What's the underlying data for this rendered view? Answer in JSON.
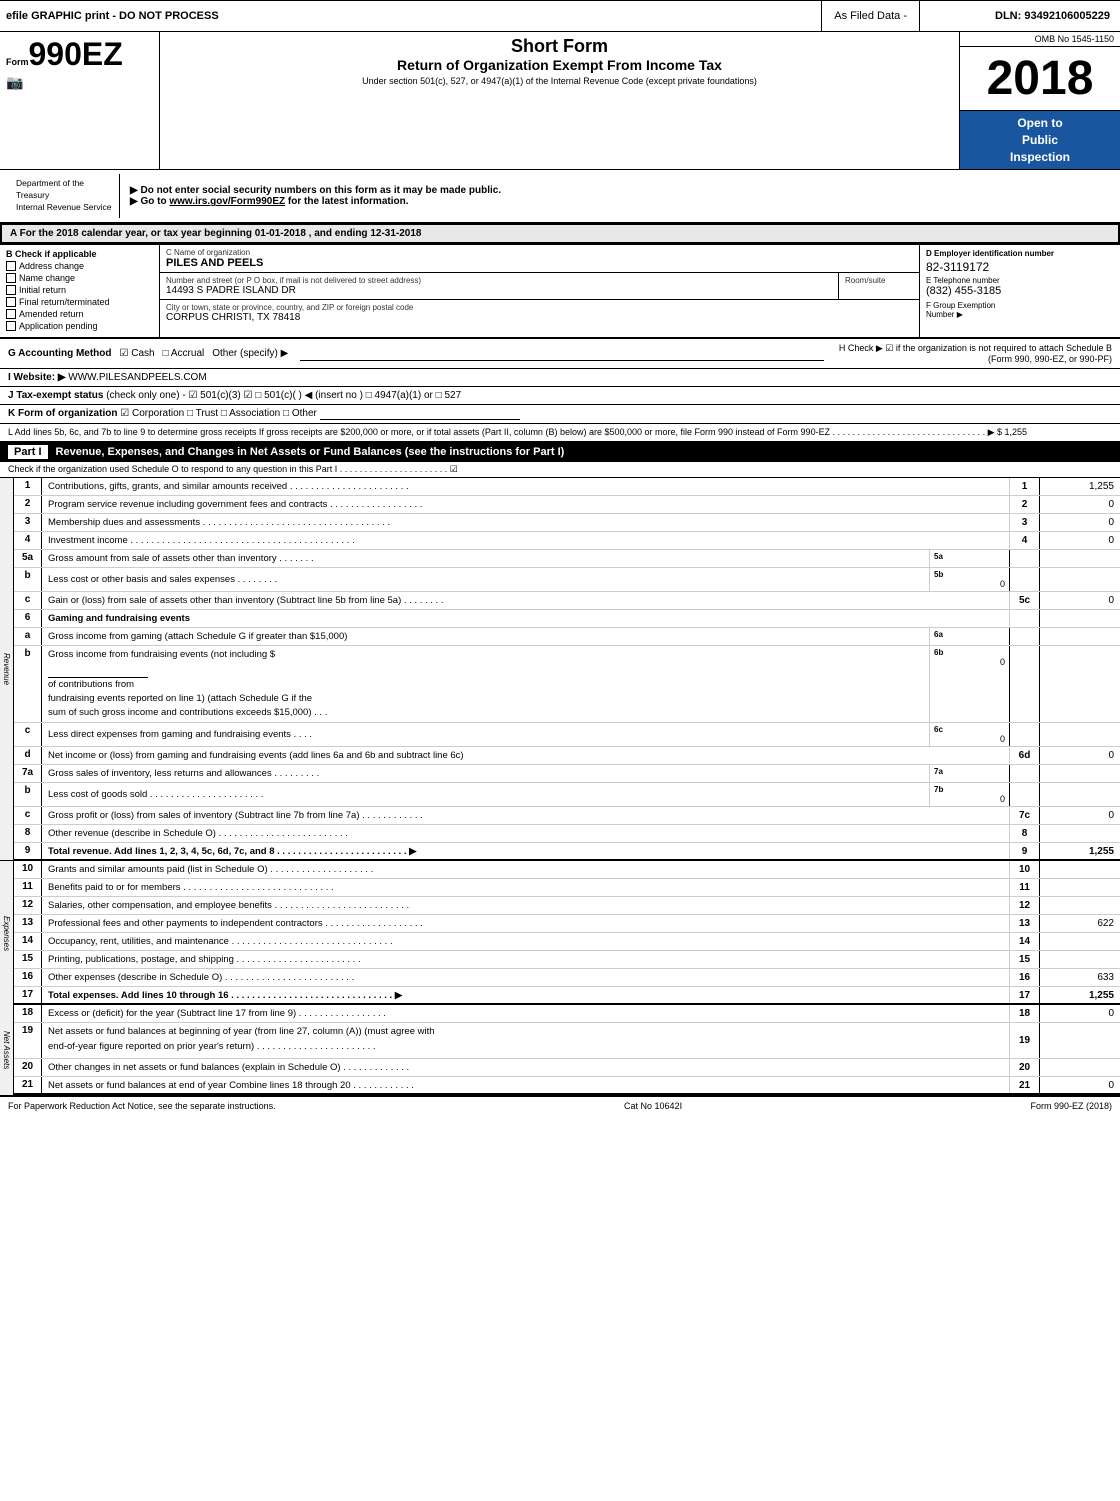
{
  "header": {
    "top_bar_text": "efile GRAPHIC print - DO NOT PROCESS",
    "as_filed_label": "As Filed Data -",
    "dln": "DLN: 93492106005229",
    "omb": "OMB No 1545-1150",
    "year": "2018",
    "open_inspection": "Open to\nPublic\nInspection",
    "form_label": "Form",
    "form_number": "990EZ",
    "short_form": "Short Form",
    "return_title": "Return of Organization Exempt From Income Tax",
    "under_section": "Under section 501(c), 527, or 4947(a)(1) of the Internal Revenue Code (except private foundations)"
  },
  "notices": {
    "notice1": "▶ Do not enter social security numbers on this form as it may be made public.",
    "notice2": "▶ Go to www.irs.gov/Form990EZ for the latest information."
  },
  "dept": {
    "name": "Department of the Treasury\nInternal Revenue Service"
  },
  "tax_year": {
    "label": "A For the 2018 calendar year, or tax year beginning 01-01-2018",
    "ending": ", and ending 12-31-2018"
  },
  "check_applicable": {
    "label": "B Check if applicable",
    "items": [
      "Address change",
      "Name change",
      "Initial return",
      "Final return/terminated",
      "Amended return",
      "Application pending"
    ]
  },
  "org": {
    "name_label": "C Name of organization",
    "name": "PILES AND PEELS",
    "address_label": "Number and street (or P O box, if mail is not delivered to street address)",
    "address": "14493 S PADRE ISLAND DR",
    "room_label": "Room/suite",
    "room": "",
    "city_label": "City or town, state or province, country, and ZIP or foreign postal code",
    "city": "CORPUS CHRISTI, TX 78418"
  },
  "ein": {
    "label": "D Employer identification number",
    "value": "82-3119172",
    "phone_label": "E Telephone number",
    "phone": "(832) 455-3185",
    "group_label": "F Group Exemption",
    "group_sub": "Number",
    "group_arrow": "▶"
  },
  "accounting": {
    "label": "G Accounting Method",
    "cash_checked": true,
    "cash_label": "☑ Cash",
    "accrual_label": "□ Accrual",
    "other_label": "Other (specify) ▶",
    "h_label": "H Check ▶ ☑ if the organization is not required to attach Schedule B (Form 990, 990-EZ, or 990-PF)"
  },
  "website": {
    "label": "I Website: ▶",
    "value": "WWW.PILESANDPEELS.COM"
  },
  "tax_status": {
    "label": "J Tax-exempt status (check only one) - ☑ 501(c)(3) ☑ □ 501(c)( ) ◀ (insert no ) □ 4947(a)(1) or □ 527"
  },
  "form_org": {
    "label": "K Form of organization",
    "value": "☑ Corporation □ Trust □ Association □ Other"
  },
  "lines_note": {
    "text": "L Add lines 5b, 6c, and 7b to line 9 to determine gross receipts If gross receipts are $200,000 or more, or if total assets (Part II, column (B) below) are $500,000 or more, file Form 990 instead of Form 990-EZ . . . . . . . . . . . . . . . . . . . . . . . . . . . . . . . ▶ $ 1,255"
  },
  "part1": {
    "label": "Part I",
    "title": "Revenue, Expenses, and Changes in Net Assets or Fund Balances (see the instructions for Part I)",
    "schedule_o": "Check if the organization used Schedule O to respond to any question in this Part I . . . . . . . . . . . . . . . . . . . . . . ☑"
  },
  "rows": [
    {
      "num": "1",
      "desc": "Contributions, gifts, grants, and similar amounts received . . . . . . . . . . . . . . . . . . . . . . .",
      "line_num": "1",
      "value": "1,255",
      "bold": false,
      "section": "revenue"
    },
    {
      "num": "2",
      "desc": "Program service revenue including government fees and contracts . . . . . . . . . . . . . . . . . .",
      "line_num": "2",
      "value": "0",
      "bold": false,
      "section": "revenue"
    },
    {
      "num": "3",
      "desc": "Membership dues and assessments . . . . . . . . . . . . . . . . . . . . . . . . . . . . . . . . . . . .",
      "line_num": "3",
      "value": "0",
      "bold": false,
      "section": "revenue"
    },
    {
      "num": "4",
      "desc": "Investment income . . . . . . . . . . . . . . . . . . . . . . . . . . . . . . . . . . . . . . . . . . .",
      "line_num": "4",
      "value": "0",
      "bold": false,
      "section": "revenue"
    },
    {
      "num": "5a",
      "desc": "Gross amount from sale of assets other than inventory  .  .  .  .  .  .  .",
      "line_num": "5a",
      "value": "",
      "bold": false,
      "section": "revenue",
      "has_mid": true,
      "mid_label": "5a",
      "mid_value": ""
    },
    {
      "num": "b",
      "desc": "Less  cost or other basis and sales expenses  .  .  .  .  .  .  .  .",
      "line_num": "5b",
      "value": "0",
      "bold": false,
      "section": "revenue",
      "has_mid": true,
      "mid_label": "5b",
      "mid_value": ""
    },
    {
      "num": "c",
      "desc": "Gain or (loss) from sale of assets other than inventory (Subtract line 5b from line 5a) .  .  .  .  .  .  .  .",
      "line_num": "5c",
      "value": "0",
      "bold": false,
      "section": "revenue"
    },
    {
      "num": "6",
      "desc": "Gaming and fundraising events",
      "line_num": "",
      "value": "",
      "bold": false,
      "section": "revenue",
      "is_header": true
    },
    {
      "num": "a",
      "desc": "Gross income from gaming (attach Schedule G if greater than $15,000)",
      "line_num": "6a",
      "value": "",
      "bold": false,
      "section": "revenue",
      "has_mid": true,
      "mid_label": "6a",
      "mid_value": ""
    },
    {
      "num": "b",
      "desc": "Gross income from fundraising events (not including $ ____________ of contributions from fundraising events reported on line 1) (attach Schedule G if the sum of such gross income and contributions exceeds $15,000)  .  .  .",
      "line_num": "6b",
      "value": "0",
      "bold": false,
      "section": "revenue",
      "has_mid": true,
      "mid_label": "6b",
      "mid_value": ""
    },
    {
      "num": "c",
      "desc": "Less  direct expenses from gaming and fundraising events  .  .  .  .",
      "line_num": "6c",
      "value": "0",
      "bold": false,
      "section": "revenue",
      "has_mid": true,
      "mid_label": "6c",
      "mid_value": ""
    },
    {
      "num": "d",
      "desc": "Net income or (loss) from gaming and fundraising events (add lines 6a and 6b and subtract line 6c)",
      "line_num": "6d",
      "value": "0",
      "bold": false,
      "section": "revenue"
    },
    {
      "num": "7a",
      "desc": "Gross sales of inventory, less returns and allowances  .  .  .  .  .  .  .  .  .",
      "line_num": "7a",
      "value": "",
      "bold": false,
      "section": "revenue",
      "has_mid": true,
      "mid_label": "7a",
      "mid_value": ""
    },
    {
      "num": "b",
      "desc": "Less  cost of goods sold  .  .  .  .  .  .  .  .  .  .  .  .  .  .  .  .  .  .  .  .  .  .",
      "line_num": "7b",
      "value": "0",
      "bold": false,
      "section": "revenue",
      "has_mid": true,
      "mid_label": "7b",
      "mid_value": ""
    },
    {
      "num": "c",
      "desc": "Gross profit or (loss) from sales of inventory (Subtract line 7b from line 7a) .  .  .  .  .  .  .  .  .  .  .  .",
      "line_num": "7c",
      "value": "0",
      "bold": false,
      "section": "revenue"
    },
    {
      "num": "8",
      "desc": "Other revenue (describe in Schedule O)  .  .  .  .  .  .  .  .  .  .  .  .  .  .  .  .  .  .  .  .  .  .  .  .  .",
      "line_num": "8",
      "value": "",
      "bold": false,
      "section": "revenue"
    },
    {
      "num": "9",
      "desc": "Total revenue. Add lines 1, 2, 3, 4, 5c, 6d, 7c, and 8 . . . . . . . . . . . . . . . . . . . . . . . . . ▶",
      "line_num": "9",
      "value": "1,255",
      "bold": true,
      "section": "revenue"
    },
    {
      "num": "10",
      "desc": "Grants and similar amounts paid (list in Schedule O)  .  .  .  .  .  .  .  .  .  .  .  .  .  .  .  .  .  .  .  .",
      "line_num": "10",
      "value": "",
      "bold": false,
      "section": "expenses"
    },
    {
      "num": "11",
      "desc": "Benefits paid to or for members  .  .  .  .  .  .  .  .  .  .  .  .  .  .  .  .  .  .  .  .  .  .  .  .  .  .  .  .  .",
      "line_num": "11",
      "value": "",
      "bold": false,
      "section": "expenses"
    },
    {
      "num": "12",
      "desc": "Salaries, other compensation, and employee benefits . . . . . . . . . . . . . . . . . . . . . . . . . .",
      "line_num": "12",
      "value": "",
      "bold": false,
      "section": "expenses"
    },
    {
      "num": "13",
      "desc": "Professional fees and other payments to independent contractors . . . . . . . . . . . . . . . . . . .",
      "line_num": "13",
      "value": "622",
      "bold": false,
      "section": "expenses"
    },
    {
      "num": "14",
      "desc": "Occupancy, rent, utilities, and maintenance . . . . . . . . . . . . . . . . . . . . . . . . . . . . . . .",
      "line_num": "14",
      "value": "",
      "bold": false,
      "section": "expenses"
    },
    {
      "num": "15",
      "desc": "Printing, publications, postage, and shipping  .  .  .  .  .  .  .  .  .  .  .  .  .  .  .  .  .  .  .  .  .  .  .  .",
      "line_num": "15",
      "value": "",
      "bold": false,
      "section": "expenses"
    },
    {
      "num": "16",
      "desc": "Other expenses (describe in Schedule O)  .  .  .  .  .  .  .  .  .  .  .  .  .  .  .  .  .  .  .  .  .  .  .  .  .",
      "line_num": "16",
      "value": "633",
      "bold": false,
      "section": "expenses"
    },
    {
      "num": "17",
      "desc": "Total expenses. Add lines 10 through 16 . . . . . . . . . . . . . . . . . . . . . . . . . . . . . . . ▶",
      "line_num": "17",
      "value": "1,255",
      "bold": true,
      "section": "expenses"
    },
    {
      "num": "18",
      "desc": "Excess or (deficit) for the year (Subtract line 17 from line 9)  .  .  .  .  .  .  .  .  .  .  .  .  .  .  .  .  .",
      "line_num": "18",
      "value": "0",
      "bold": false,
      "section": "netassets"
    },
    {
      "num": "19",
      "desc": "Net assets or fund balances at beginning of year (from line 27, column (A)) (must agree with end-of-year figure reported on prior year's return)  .  .  .  .  .  .  .  .  .  .  .  .  .  .  .  .  .  .  .  .  .  .  .",
      "line_num": "19",
      "value": "",
      "bold": false,
      "section": "netassets"
    },
    {
      "num": "20",
      "desc": "Other changes in net assets or fund balances (explain in Schedule O)  .  .  .  .  .  .  .  .  .  .  .  .  .",
      "line_num": "20",
      "value": "",
      "bold": false,
      "section": "netassets"
    },
    {
      "num": "21",
      "desc": "Net assets or fund balances at end of year  Combine lines 18 through 20  .  .  .  .  .  .  .  .  .  .  .  .",
      "line_num": "21",
      "value": "0",
      "bold": false,
      "section": "netassets"
    }
  ],
  "footer": {
    "left": "For Paperwork Reduction Act Notice, see the separate instructions.",
    "center": "Cat No 10642I",
    "right": "Form 990-EZ (2018)"
  }
}
